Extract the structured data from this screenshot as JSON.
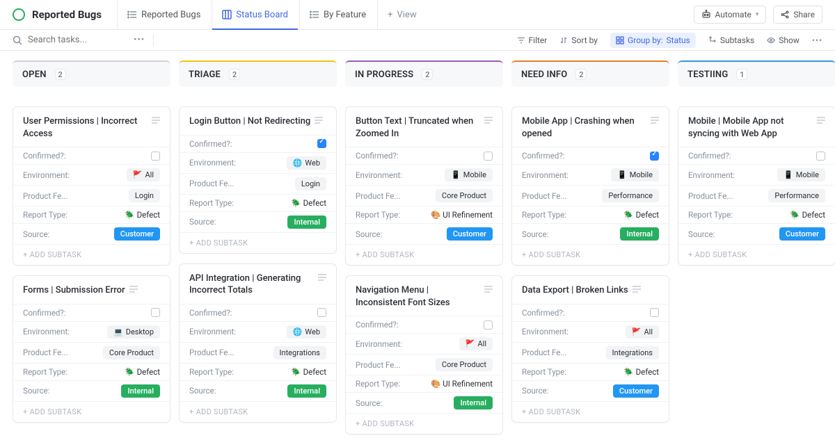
{
  "page_title": "Reported Bugs",
  "view_tabs": [
    {
      "label": "Reported Bugs",
      "icon": "list"
    },
    {
      "label": "Status Board",
      "icon": "board",
      "active": true
    },
    {
      "label": "By Feature",
      "icon": "list"
    }
  ],
  "add_view_label": "View",
  "top_actions": {
    "automate": "Automate",
    "share": "Share"
  },
  "search_placeholder": "Search tasks...",
  "filters": {
    "filter": "Filter",
    "sort": "Sort by",
    "group_label": "Group by:",
    "group_value": "Status",
    "subtasks": "Subtasks",
    "show": "Show"
  },
  "add_subtask_label": "+ ADD SUBTASK",
  "field_labels": {
    "confirmed": "Confirmed?:",
    "environment": "Environment:",
    "product_feature": "Product Fe...",
    "report_type": "Report Type:",
    "source": "Source:"
  },
  "columns": [
    {
      "title": "OPEN",
      "count": "2",
      "color": "#cfd3da",
      "cards": [
        {
          "title": "User Permissions | Incorrect Access",
          "confirmed": false,
          "environment": {
            "emoji": "🚩",
            "text": "All"
          },
          "product_feature": "Login",
          "report_type": {
            "emoji": "🪲",
            "text": "Defect"
          },
          "source": {
            "text": "Customer",
            "kind": "customer"
          }
        },
        {
          "title": "Forms | Submission Error",
          "confirmed": false,
          "environment": {
            "emoji": "💻",
            "text": "Desktop"
          },
          "product_feature": "Core Product",
          "report_type": {
            "emoji": "🪲",
            "text": "Defect"
          },
          "source": {
            "text": "Internal",
            "kind": "internal"
          }
        }
      ]
    },
    {
      "title": "TRIAGE",
      "count": "2",
      "color": "#f1c40f",
      "cards": [
        {
          "title": "Login Button | Not Redirecting",
          "confirmed": true,
          "environment": {
            "emoji": "🌐",
            "text": "Web"
          },
          "product_feature": "Login",
          "report_type": {
            "emoji": "🪲",
            "text": "Defect"
          },
          "source": {
            "text": "Internal",
            "kind": "internal"
          }
        },
        {
          "title": "API Integration | Generating Incorrect Totals",
          "confirmed": false,
          "environment": {
            "emoji": "🌐",
            "text": "Web"
          },
          "product_feature": "Integrations",
          "report_type": {
            "emoji": "🪲",
            "text": "Defect"
          },
          "source": {
            "text": "Internal",
            "kind": "internal"
          }
        }
      ]
    },
    {
      "title": "IN PROGRESS",
      "count": "2",
      "color": "#9b59b6",
      "cards": [
        {
          "title": "Button Text | Truncated when Zoomed In",
          "confirmed": false,
          "environment": {
            "emoji": "📱",
            "text": "Mobile"
          },
          "product_feature": "Core Product",
          "report_type": {
            "emoji": "🎨",
            "text": "UI Refinement"
          },
          "source": {
            "text": "Customer",
            "kind": "customer"
          }
        },
        {
          "title": "Navigation Menu | Inconsistent Font Sizes",
          "confirmed": false,
          "environment": {
            "emoji": "🚩",
            "text": "All"
          },
          "product_feature": "Core Product",
          "report_type": {
            "emoji": "🎨",
            "text": "UI Refinement"
          },
          "source": {
            "text": "Internal",
            "kind": "internal"
          }
        }
      ]
    },
    {
      "title": "NEED INFO",
      "count": "2",
      "color": "#e67e22",
      "cards": [
        {
          "title": "Mobile App | Crashing when opened",
          "confirmed": true,
          "environment": {
            "emoji": "📱",
            "text": "Mobile"
          },
          "product_feature": "Performance",
          "report_type": {
            "emoji": "🪲",
            "text": "Defect"
          },
          "source": {
            "text": "Internal",
            "kind": "internal"
          }
        },
        {
          "title": "Data Export | Broken Links",
          "confirmed": false,
          "environment": {
            "emoji": "🚩",
            "text": "All"
          },
          "product_feature": "Integrations",
          "report_type": {
            "emoji": "🪲",
            "text": "Defect"
          },
          "source": {
            "text": "Customer",
            "kind": "customer"
          }
        }
      ]
    },
    {
      "title": "TESTIING",
      "count": "1",
      "color": "#3498db",
      "cards": [
        {
          "title": "Mobile | Mobile App not syncing with Web App",
          "confirmed": false,
          "environment": {
            "emoji": "📱",
            "text": "Mobile"
          },
          "product_feature": "Performance",
          "report_type": {
            "emoji": "🪲",
            "text": "Defect"
          },
          "source": {
            "text": "Customer",
            "kind": "customer"
          }
        }
      ]
    }
  ]
}
